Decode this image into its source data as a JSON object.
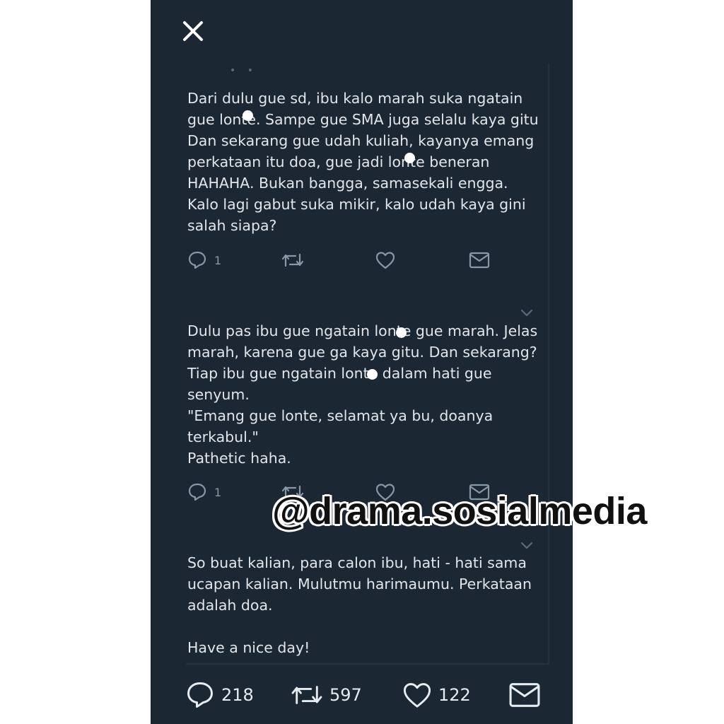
{
  "thread": {
    "continuation_dots": "• •",
    "tweets": [
      {
        "lines": [
          "Dari dulu gue sd, ibu kalo marah suka ngatain",
          "gue lonte. Sampe gue SMA juga selalu kaya gitu",
          "Dan sekarang gue udah kuliah, kayanya emang",
          "perkataan itu doa, gue jadi lonte beneran",
          "HAHAHA. Bukan bangga, samasekali engga.",
          "Kalo lagi gabut suka mikir, kalo udah kaya gini",
          "salah siapa?"
        ],
        "reply_count": "1"
      },
      {
        "lines": [
          "Dulu pas ibu gue ngatain lonte gue marah. Jelas",
          "marah, karena gue ga kaya gitu. Dan sekarang?",
          "Tiap ibu gue ngatain lonte dalam hati gue",
          "senyum.",
          "\"Emang gue lonte, selamat ya bu, doanya",
          "terkabul.\"",
          "Pathetic haha."
        ],
        "reply_count": "1"
      },
      {
        "lines": [
          "So buat kalian, para calon ibu, hati - hati sama",
          "ucapan kalian. Mulutmu harimaumu. Perkataan",
          "adalah doa.",
          "",
          "Have a nice day!"
        ]
      }
    ]
  },
  "bottom_actions": {
    "replies": "218",
    "retweets": "597",
    "likes": "122"
  },
  "watermark": "@drama.sosialmedia",
  "colors": {
    "background": "#1b2733",
    "text": "#e2e6ea",
    "icon_muted": "#8899a6"
  },
  "icons": [
    "close-icon",
    "reply-icon",
    "retweet-icon",
    "like-icon",
    "dm-icon",
    "chevron-down-icon"
  ]
}
